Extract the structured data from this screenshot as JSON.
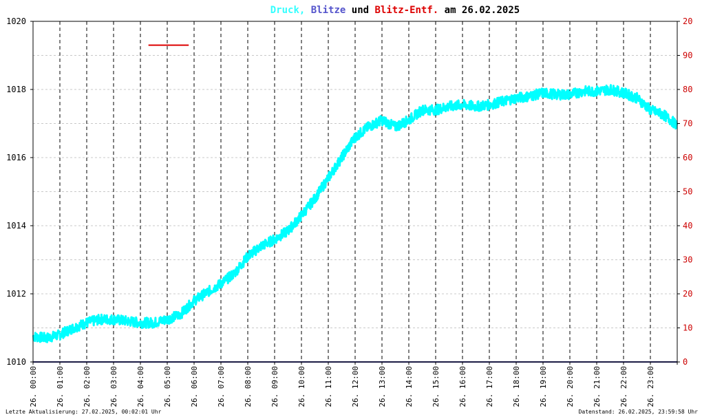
{
  "title": {
    "parts": [
      {
        "text": "Druck,",
        "color": "#33ffff"
      },
      {
        "text": "Blitze",
        "color": "#5555cc"
      },
      {
        "text": "und",
        "color": "#000000"
      },
      {
        "text": "Blitz-Entf.",
        "color": "#dd0000"
      },
      {
        "text": "am 26.02.2025",
        "color": "#000000"
      }
    ]
  },
  "footer": {
    "left": "Letzte Aktualisierung: 27.02.2025, 00:02:01 Uhr",
    "right": "Datenstand: 26.02.2025, 23:59:58 Uhr"
  },
  "chart_data": {
    "type": "line",
    "title": "Druck, Blitze und Blitz-Entf. am 26.02.2025",
    "x_range_hours": [
      0,
      24
    ],
    "x_tick_labels": [
      "26. 00:00",
      "26. 01:00",
      "26. 02:00",
      "26. 03:00",
      "26. 04:00",
      "26. 05:00",
      "26. 06:00",
      "26. 07:00",
      "26. 08:00",
      "26. 09:00",
      "26. 10:00",
      "26. 11:00",
      "26. 12:00",
      "26. 13:00",
      "26. 14:00",
      "26. 15:00",
      "26. 16:00",
      "26. 17:00",
      "26. 18:00",
      "26. 19:00",
      "26. 20:00",
      "26. 21:00",
      "26. 22:00",
      "26. 23:00"
    ],
    "y_left": {
      "min": 1010,
      "max": 1020,
      "ticks": [
        "1010",
        "1012",
        "1014",
        "1016",
        "1018",
        "1020"
      ]
    },
    "y_right": {
      "min": 0,
      "max": 100,
      "ticks": [
        "0",
        "10",
        "20",
        "30",
        "40",
        "50",
        "60",
        "70",
        "80",
        "90",
        "20"
      ]
    },
    "grid": true,
    "series": [
      {
        "name": "Druck",
        "color": "#00ffff",
        "axis": "left",
        "x": [
          0,
          0.5,
          1,
          1.5,
          2,
          2.5,
          3,
          3.5,
          4,
          4.5,
          5,
          5.5,
          6,
          6.5,
          7,
          7.5,
          8,
          8.5,
          9,
          9.5,
          10,
          10.5,
          11,
          11.5,
          12,
          12.5,
          13,
          13.5,
          14,
          14.5,
          15,
          15.5,
          16,
          16.5,
          17,
          17.5,
          18,
          18.5,
          19,
          19.5,
          20,
          20.5,
          21,
          21.5,
          22,
          22.5,
          23,
          23.5,
          24
        ],
        "y": [
          1010.75,
          1010.7,
          1010.8,
          1011.0,
          1011.15,
          1011.25,
          1011.25,
          1011.2,
          1011.15,
          1011.15,
          1011.25,
          1011.4,
          1011.8,
          1012.05,
          1012.3,
          1012.6,
          1013.1,
          1013.4,
          1013.6,
          1013.85,
          1014.3,
          1014.8,
          1015.4,
          1016.0,
          1016.6,
          1016.9,
          1017.1,
          1016.9,
          1017.1,
          1017.4,
          1017.4,
          1017.5,
          1017.55,
          1017.5,
          1017.55,
          1017.65,
          1017.75,
          1017.8,
          1017.9,
          1017.85,
          1017.85,
          1017.95,
          1017.95,
          1018.0,
          1017.9,
          1017.75,
          1017.4,
          1017.25,
          1016.95
        ]
      },
      {
        "name": "Blitze",
        "color": "#333388",
        "axis": "right",
        "x": [
          0,
          24
        ],
        "y": [
          0,
          0
        ]
      },
      {
        "name": "Blitz-Entf.",
        "color": "#dd0000",
        "axis": "right",
        "x": [
          4.3,
          5.8
        ],
        "y": [
          93,
          93
        ]
      }
    ]
  }
}
